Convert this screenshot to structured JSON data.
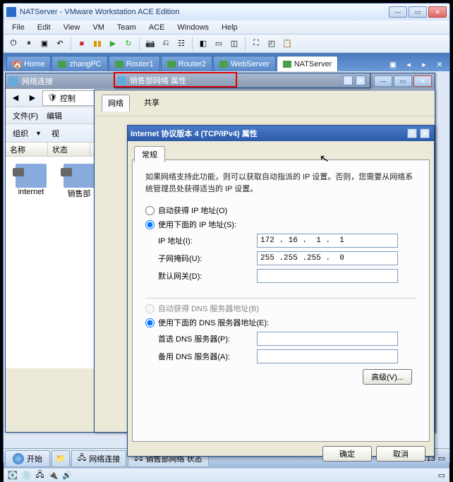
{
  "app": {
    "title": "NATServer - VMware Workstation ACE Edition"
  },
  "menu": [
    "File",
    "Edit",
    "View",
    "VM",
    "Team",
    "ACE",
    "Windows",
    "Help"
  ],
  "vmtabs": [
    {
      "label": "Home"
    },
    {
      "label": "zhangPC"
    },
    {
      "label": "Router1"
    },
    {
      "label": "Router2"
    },
    {
      "label": "WebServer"
    },
    {
      "label": "NATServer",
      "active": true
    }
  ],
  "explorer": {
    "title": "网络连接",
    "filemenu": "文件(F)",
    "editmenu": "编辑",
    "org": "组织",
    "view": "视",
    "col_name": "名称",
    "col_status": "状态",
    "items": [
      {
        "label": "internet"
      },
      {
        "label": "销售部"
      }
    ],
    "ctrl": "控制"
  },
  "propwin": {
    "title": "销售部网络 属性",
    "tab_net": "网络",
    "tab_share": "共享"
  },
  "ipv4": {
    "title": "Internet 协议版本 4 (TCP/IPv4) 属性",
    "tab": "常规",
    "desc": "如果网络支持此功能，则可以获取自动指派的 IP 设置。否则，您需要从网络系统管理员处获得适当的 IP 设置。",
    "auto_ip": "自动获得 IP 地址(O)",
    "use_ip": "使用下面的 IP 地址(S):",
    "ip_label": "IP 地址(I):",
    "ip_value": "172 . 16 .  1 .  1",
    "mask_label": "子网掩码(U):",
    "mask_value": "255 .255 .255 .  0",
    "gw_label": "默认网关(D):",
    "gw_value": "",
    "auto_dns": "自动获得 DNS 服务器地址(B)",
    "use_dns": "使用下面的 DNS 服务器地址(E):",
    "dns1_label": "首选 DNS 服务器(P):",
    "dns1_value": "",
    "dns2_label": "备用 DNS 服务器(A):",
    "dns2_value": "",
    "adv": "高级(V)...",
    "ok": "确定",
    "cancel": "取消"
  },
  "taskbar": {
    "start": "开始",
    "items": [
      "",
      "网络连接",
      "销售部网络 状态"
    ],
    "time": "18:13"
  }
}
